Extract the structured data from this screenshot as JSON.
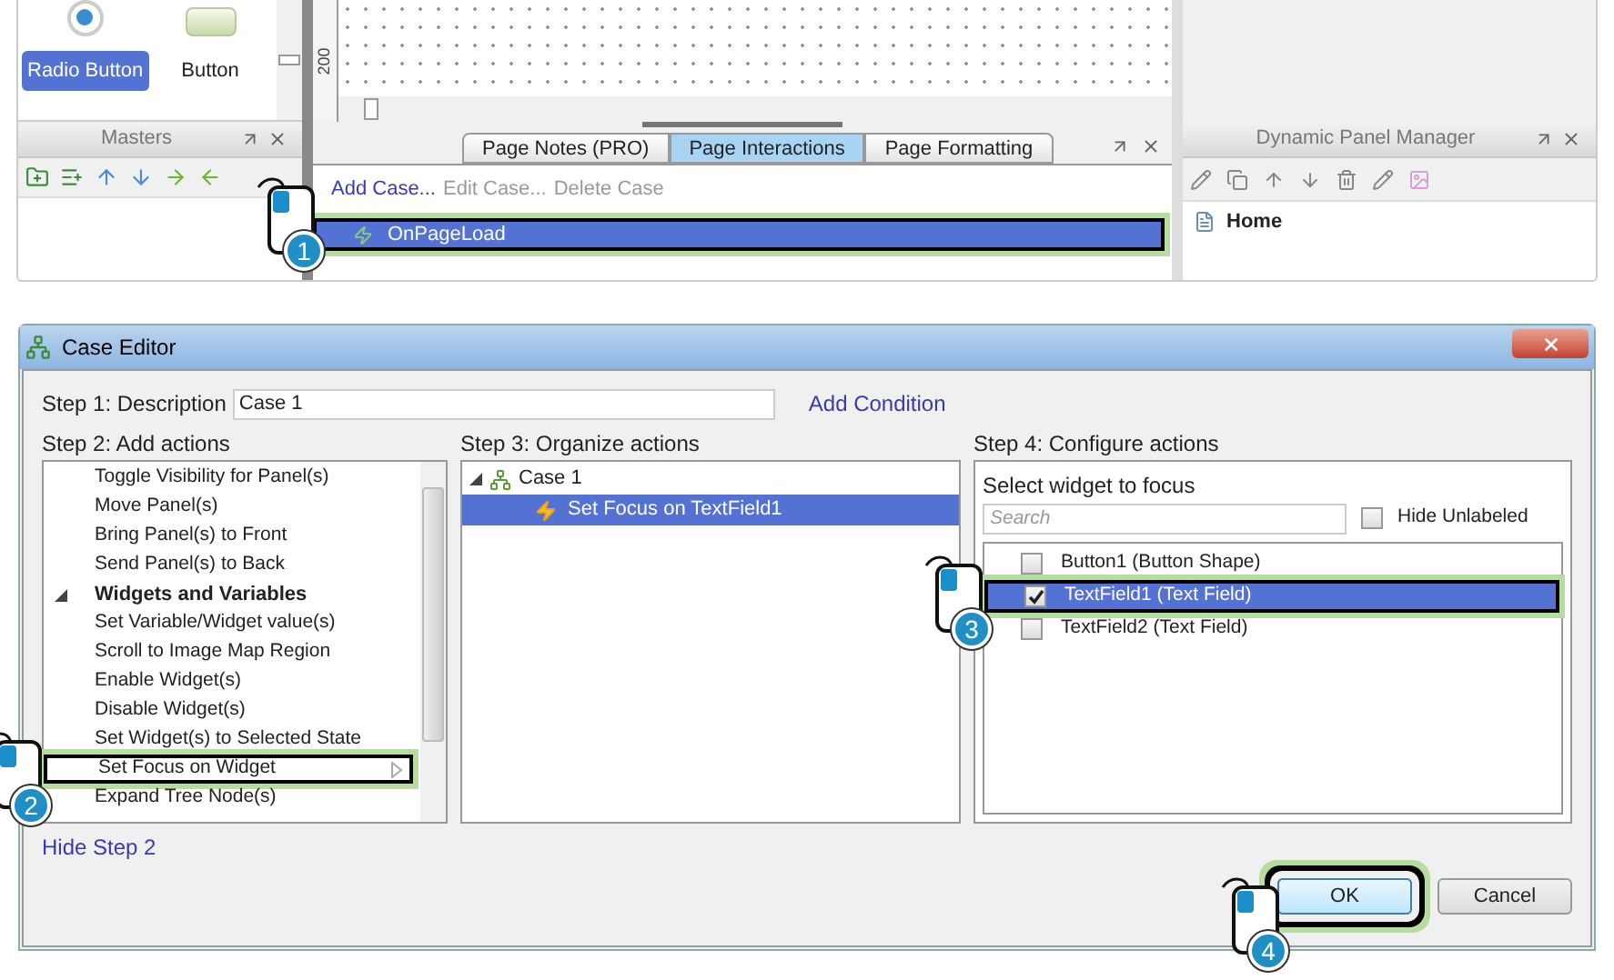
{
  "widgets_panel": {
    "items": [
      {
        "label": "Radio Button",
        "kind": "radio",
        "selected": true
      },
      {
        "label": "Button",
        "kind": "button",
        "selected": false
      }
    ]
  },
  "canvas": {
    "ruler_label": "200"
  },
  "masters": {
    "title": "Masters"
  },
  "page_panel": {
    "tabs": [
      {
        "label": "Page Notes (PRO)",
        "selected": false
      },
      {
        "label": "Page Interactions",
        "selected": true
      },
      {
        "label": "Page Formatting",
        "selected": false
      }
    ],
    "actions": [
      {
        "label": "Add Case...",
        "disabled": false
      },
      {
        "label": "Edit Case...",
        "disabled": true
      },
      {
        "label": "Delete Case",
        "disabled": true
      }
    ],
    "events": [
      {
        "label": "OnPageLoad",
        "selected": true,
        "highlighted": true
      }
    ]
  },
  "dynamic_panel_manager": {
    "title": "Dynamic Panel Manager",
    "items": [
      {
        "label": "Home"
      }
    ]
  },
  "case_editor": {
    "title": "Case Editor",
    "step1": {
      "label": "Step 1: Description",
      "value": "Case 1",
      "link": "Add Condition"
    },
    "step2": {
      "label": "Step 2: Add actions",
      "items": [
        {
          "label": "Toggle Visibility for Panel(s)",
          "kind": "action",
          "highlighted": false
        },
        {
          "label": "Move Panel(s)",
          "kind": "action",
          "highlighted": false
        },
        {
          "label": "Bring Panel(s) to Front",
          "kind": "action",
          "highlighted": false
        },
        {
          "label": "Send Panel(s) to Back",
          "kind": "action",
          "highlighted": false
        },
        {
          "label": "Widgets and Variables",
          "kind": "group",
          "highlighted": false
        },
        {
          "label": "Set Variable/Widget value(s)",
          "kind": "action",
          "highlighted": false
        },
        {
          "label": "Scroll to Image Map Region",
          "kind": "action",
          "highlighted": false
        },
        {
          "label": "Enable Widget(s)",
          "kind": "action",
          "highlighted": false
        },
        {
          "label": "Disable Widget(s)",
          "kind": "action",
          "highlighted": false
        },
        {
          "label": "Set Widget(s) to Selected State",
          "kind": "action",
          "highlighted": false
        },
        {
          "label": "Set Focus on Widget",
          "kind": "action",
          "highlighted": true
        },
        {
          "label": "Expand Tree Node(s)",
          "kind": "action",
          "highlighted": false
        }
      ]
    },
    "step3": {
      "label": "Step 3: Organize actions",
      "tree": [
        {
          "label": "Case 1",
          "selected": false,
          "children": [
            {
              "label": "Set Focus on TextField1",
              "selected": true
            }
          ]
        }
      ]
    },
    "step4": {
      "label": "Step 4: Configure actions",
      "heading": "Select widget to focus",
      "search_placeholder": "Search",
      "hide_unlabeled": {
        "label": "Hide Unlabeled",
        "checked": false
      },
      "widgets": [
        {
          "label": "Button1 (Button Shape)",
          "checked": false,
          "selected": false,
          "highlighted": false
        },
        {
          "label": "TextField1 (Text Field)",
          "checked": true,
          "selected": true,
          "highlighted": true
        },
        {
          "label": "TextField2 (Text Field)",
          "checked": false,
          "selected": false,
          "highlighted": false
        }
      ]
    },
    "hide_step_link": "Hide Step 2",
    "buttons": [
      {
        "label": "OK",
        "highlighted": true
      },
      {
        "label": "Cancel",
        "highlighted": false
      }
    ]
  },
  "callouts": [
    {
      "number": "1"
    },
    {
      "number": "2"
    },
    {
      "number": "3"
    },
    {
      "number": "4"
    }
  ]
}
